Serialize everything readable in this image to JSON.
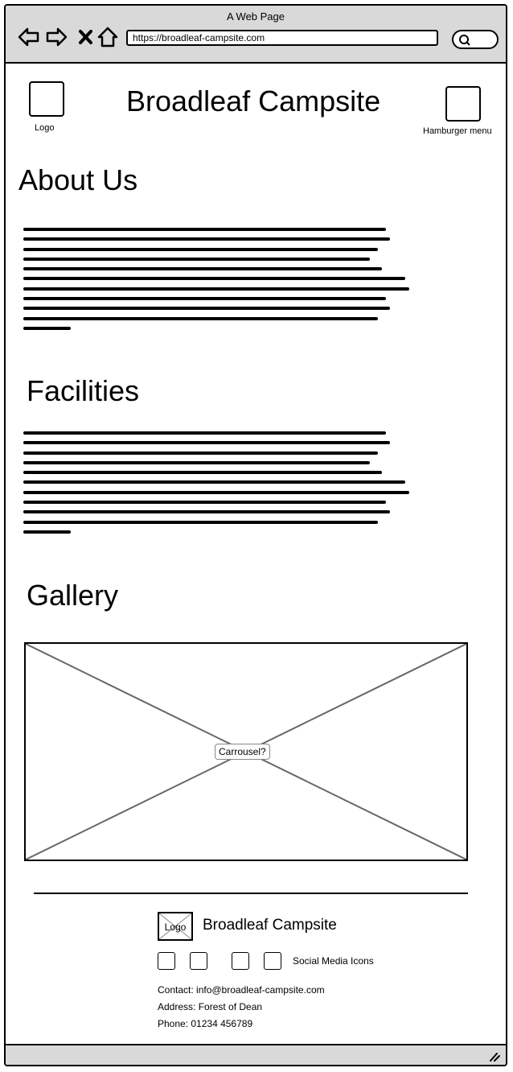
{
  "browser": {
    "window_title": "A Web Page",
    "url": "https://broadleaf-campsite.com"
  },
  "header": {
    "logo_label": "Logo",
    "site_title": "Broadleaf Campsite",
    "menu_label": "Hamburger menu"
  },
  "sections": {
    "about_heading": "About Us",
    "facilities_heading": "Facilities",
    "gallery_heading": "Gallery"
  },
  "gallery": {
    "carousel_label": "Carrousel?"
  },
  "footer": {
    "logo_label": "Logo",
    "site_title": "Broadleaf Campsite",
    "social_label": "Social Media Icons",
    "contact": "Contact: info@broadleaf-campsite.com",
    "address": "Address: Forest of Dean",
    "phone": "Phone: 01234 456789"
  },
  "colors": {
    "chrome_gray": "#d9d9d9",
    "placeholder_line": "#666666"
  }
}
